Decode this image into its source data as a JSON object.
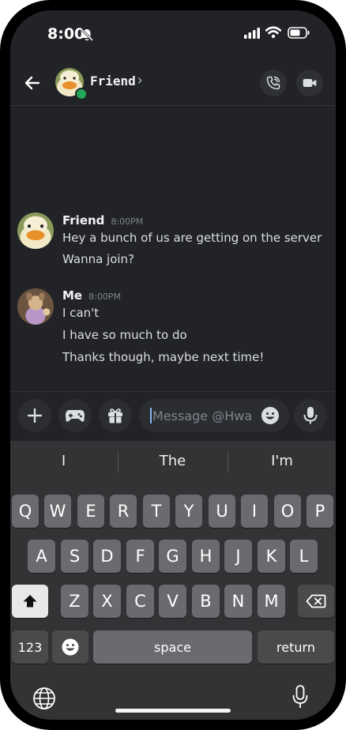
{
  "status": {
    "time": "8:00"
  },
  "header": {
    "title": "Friend",
    "chevron": "›"
  },
  "messages": [
    {
      "author": "Friend",
      "time": "8:00PM",
      "lines": [
        "Hey a bunch of us are getting on the server",
        "Wanna join?"
      ]
    },
    {
      "author": "Me",
      "time": "8:00PM",
      "lines": [
        "I can't",
        "I have so much to do",
        "Thanks though, maybe next time!"
      ]
    }
  ],
  "composer": {
    "placeholder": "Message @Hwa"
  },
  "keyboard": {
    "suggestions": [
      "I",
      "The",
      "I'm"
    ],
    "row1": [
      "Q",
      "W",
      "E",
      "R",
      "T",
      "Y",
      "U",
      "I",
      "O",
      "P"
    ],
    "row2": [
      "A",
      "S",
      "D",
      "F",
      "G",
      "H",
      "J",
      "K",
      "L"
    ],
    "row3": [
      "Z",
      "X",
      "C",
      "V",
      "B",
      "N",
      "M"
    ],
    "numbers_label": "123",
    "space_label": "space",
    "return_label": "return"
  },
  "icons": [
    "back-arrow-icon",
    "phone-icon",
    "video-icon",
    "plus-icon",
    "gamepad-icon",
    "gift-icon",
    "emoji-icon",
    "microphone-icon",
    "shift-icon",
    "backspace-icon",
    "globe-icon",
    "dictation-icon"
  ],
  "colors": {
    "background": "#222327",
    "keyboard": "#333336",
    "online": "#23a55a"
  }
}
